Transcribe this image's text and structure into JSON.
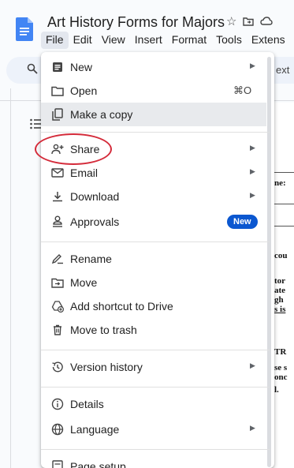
{
  "document": {
    "title": "Art History Forms for Majors"
  },
  "menubar": {
    "items": [
      "File",
      "Edit",
      "View",
      "Insert",
      "Format",
      "Tools",
      "Extens"
    ]
  },
  "toolbar": {
    "text_fragment": "ext"
  },
  "file_menu": {
    "new": "New",
    "open": "Open",
    "open_shortcut": "⌘O",
    "make_copy": "Make a copy",
    "share": "Share",
    "email": "Email",
    "download": "Download",
    "approvals": "Approvals",
    "approvals_badge": "New",
    "rename": "Rename",
    "move": "Move",
    "add_shortcut": "Add shortcut to Drive",
    "move_to_trash": "Move to trash",
    "version_history": "Version history",
    "details": "Details",
    "language": "Language",
    "page_setup": "Page setup"
  },
  "doc_fragments": {
    "f1": "ne:",
    "f2": "cou",
    "f3": "tor",
    "f4": "ate",
    "f5": "gh",
    "f6": "s is",
    "f7": "TR",
    "f8": "se s",
    "f9": "onc",
    "f10": "l."
  },
  "colors": {
    "accent": "#0b57d0",
    "highlight_ring": "#d42b3a",
    "docs_blue": "#4285f4"
  }
}
